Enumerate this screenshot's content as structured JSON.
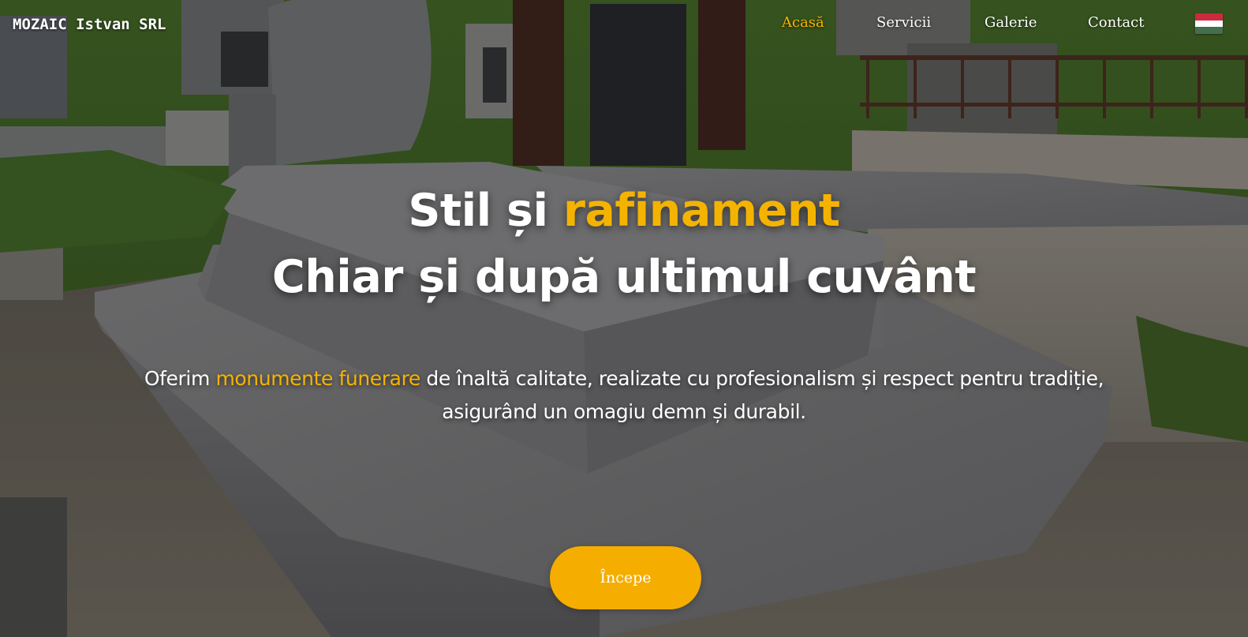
{
  "brand": {
    "name": "MOZAIC Istvan SRL"
  },
  "nav": {
    "items": [
      {
        "label": "Acasă",
        "active": true
      },
      {
        "label": "Servicii",
        "active": false
      },
      {
        "label": "Galerie",
        "active": false
      },
      {
        "label": "Contact",
        "active": false
      }
    ],
    "language_flag": {
      "icon": "hungarian-flag-icon",
      "colors": [
        "#cd2a3e",
        "#ffffff",
        "#436f4d"
      ]
    }
  },
  "hero": {
    "headline_line1_part1": "Stil și ",
    "headline_line1_accent": "rafinament",
    "headline_line2": "Chiar și după ultimul cuvânt",
    "lead_part1": "Oferim ",
    "lead_accent": "monumente funerare",
    "lead_part2": " de înaltă calitate, realizate cu profesionalism și respect pentru tradiție, asigurând un omagiu demn și durabil.",
    "cta_label": "Începe"
  },
  "colors": {
    "accent": "#f5b301",
    "cta_background": "#f5ad00",
    "text": "#ffffff"
  }
}
